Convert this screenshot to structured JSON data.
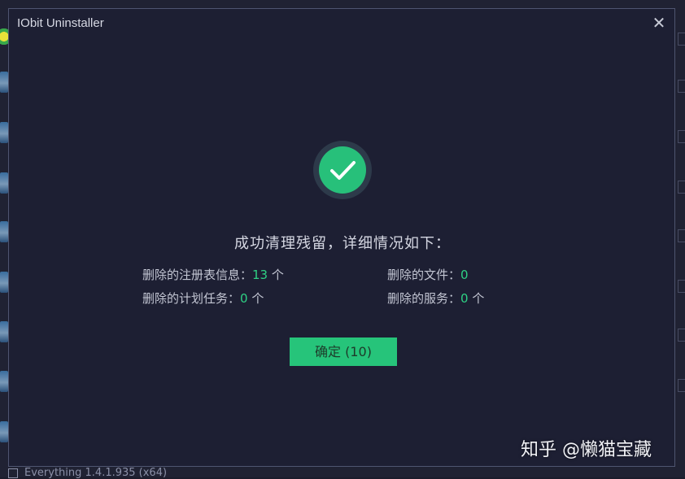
{
  "background": {
    "top_partial_text": "",
    "bottom_partial_text": "Everything 1.4.1.935 (x64)"
  },
  "dialog": {
    "title": "IObit Uninstaller",
    "close_glyph": "✕",
    "status_icon": "success-check-icon",
    "headline": "成功清理残留，详细情况如下：",
    "stats": {
      "registry": {
        "label": "删除的注册表信息：",
        "value": "13",
        "unit": " 个"
      },
      "files": {
        "label": "删除的文件：",
        "value": "0",
        "unit": ""
      },
      "tasks": {
        "label": "删除的计划任务：",
        "value": "0",
        "unit": " 个"
      },
      "services": {
        "label": "删除的服务：",
        "value": "0",
        "unit": " 个"
      }
    },
    "ok_button": "确定 (10)"
  },
  "watermark": "知乎 @懒猫宝藏",
  "colors": {
    "accent": "#26c47a",
    "number": "#2fd084",
    "dialog_bg": "#1d1f33",
    "border": "#4f5570"
  }
}
